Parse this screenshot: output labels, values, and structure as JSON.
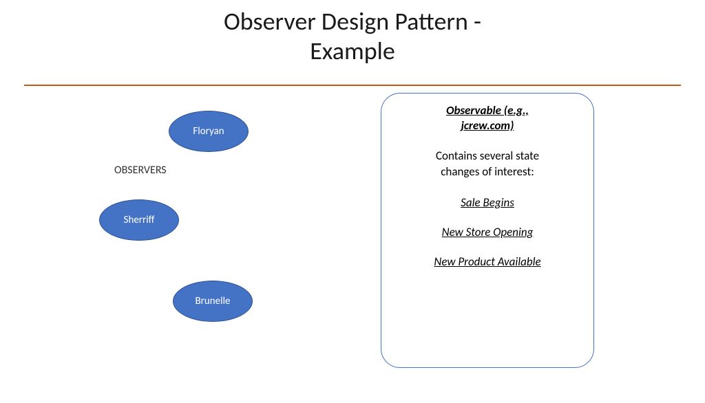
{
  "title": {
    "line1": "Observer Design Pattern -",
    "line2": "Example"
  },
  "observers": {
    "label": "OBSERVERS",
    "nodes": {
      "floryan": "Floryan",
      "sherriff": "Sherriff",
      "brunelle": "Brunelle"
    }
  },
  "observable": {
    "title_line1": "Observable (e.g.,",
    "title_line2": "jcrew.com)",
    "subtitle_line1": "Contains several state",
    "subtitle_line2": "changes of interest:",
    "events": {
      "e1": "Sale Begins",
      "e2": "New Store Opening",
      "e3": "New Product Available"
    }
  }
}
